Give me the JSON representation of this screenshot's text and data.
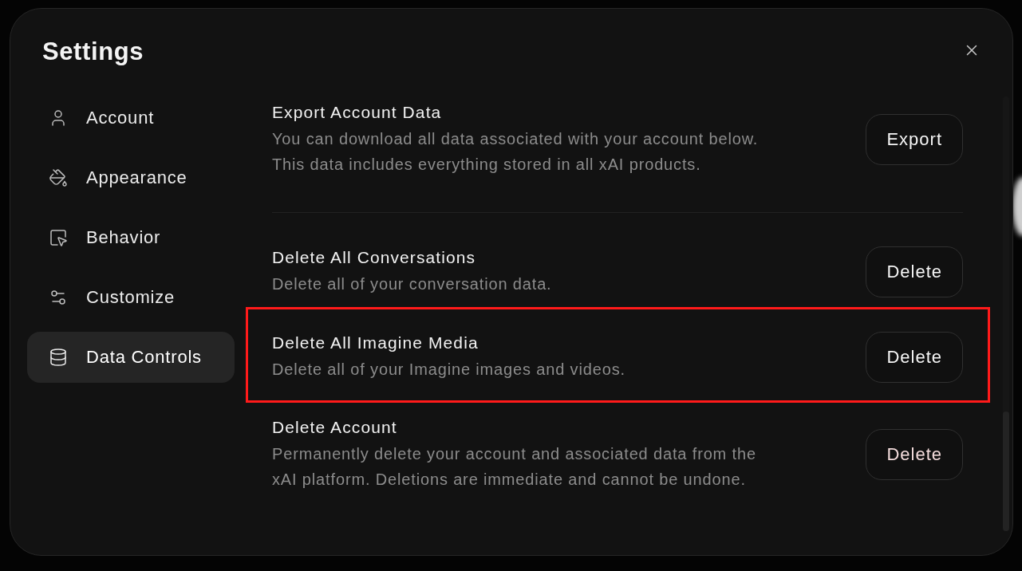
{
  "dialog": {
    "title": "Settings"
  },
  "sidebar": {
    "items": [
      {
        "label": "Account",
        "selected": false
      },
      {
        "label": "Appearance",
        "selected": false
      },
      {
        "label": "Behavior",
        "selected": false
      },
      {
        "label": "Customize",
        "selected": false
      },
      {
        "label": "Data Controls",
        "selected": true
      }
    ]
  },
  "sections": [
    {
      "rows": [
        {
          "title": "Export Account Data",
          "description": "You can download all data associated with your account below. This data includes everything stored in all xAI products.",
          "button": {
            "label": "Export",
            "danger": false
          },
          "highlighted": false
        }
      ]
    },
    {
      "rows": [
        {
          "title": "Delete All Conversations",
          "description": "Delete all of your conversation data.",
          "button": {
            "label": "Delete",
            "danger": false
          },
          "highlighted": false
        },
        {
          "title": "Delete All Imagine Media",
          "description": "Delete all of your Imagine images and videos.",
          "button": {
            "label": "Delete",
            "danger": false
          },
          "highlighted": true
        },
        {
          "title": "Delete Account",
          "description": "Permanently delete your account and associated data from the xAI platform. Deletions are immediate and cannot be undone.",
          "button": {
            "label": "Delete",
            "danger": true
          },
          "highlighted": false
        }
      ]
    }
  ]
}
